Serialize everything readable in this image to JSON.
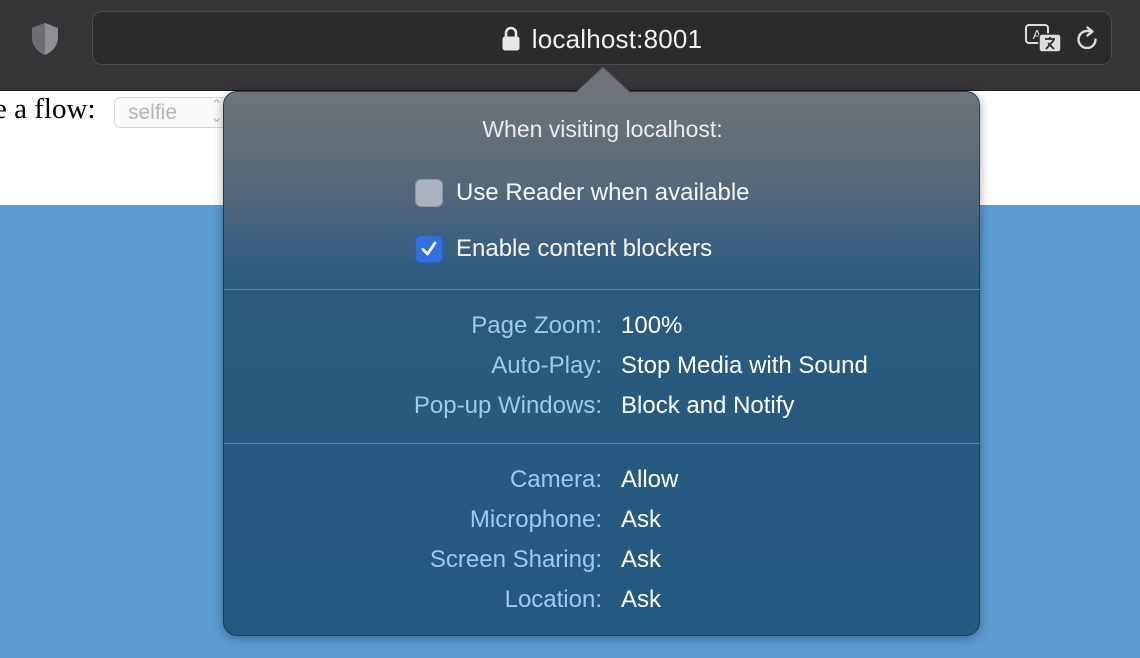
{
  "browser": {
    "url": "localhost:8001",
    "icons": {
      "privacy": "shield-icon",
      "secure": "lock-icon",
      "translate": "translate-icon",
      "reload": "reload-icon"
    }
  },
  "page": {
    "label": "e a flow:",
    "select_value": "selfie",
    "colors": {
      "background_band": "#5b9bd2"
    }
  },
  "popover": {
    "title": "When visiting localhost:",
    "checkboxes": [
      {
        "label": "Use Reader when available",
        "checked": false
      },
      {
        "label": "Enable content blockers",
        "checked": true
      }
    ],
    "settings": [
      {
        "label": "Page Zoom:",
        "value": "100%"
      },
      {
        "label": "Auto-Play:",
        "value": "Stop Media with Sound"
      },
      {
        "label": "Pop-up Windows:",
        "value": "Block and Notify"
      }
    ],
    "permissions": [
      {
        "label": "Camera:",
        "value": "Allow"
      },
      {
        "label": "Microphone:",
        "value": "Ask"
      },
      {
        "label": "Screen Sharing:",
        "value": "Ask"
      },
      {
        "label": "Location:",
        "value": "Ask"
      }
    ],
    "colors": {
      "label": "#9ccbf0",
      "value": "#ffffff",
      "checkbox_on": "#2f6fe0"
    }
  }
}
